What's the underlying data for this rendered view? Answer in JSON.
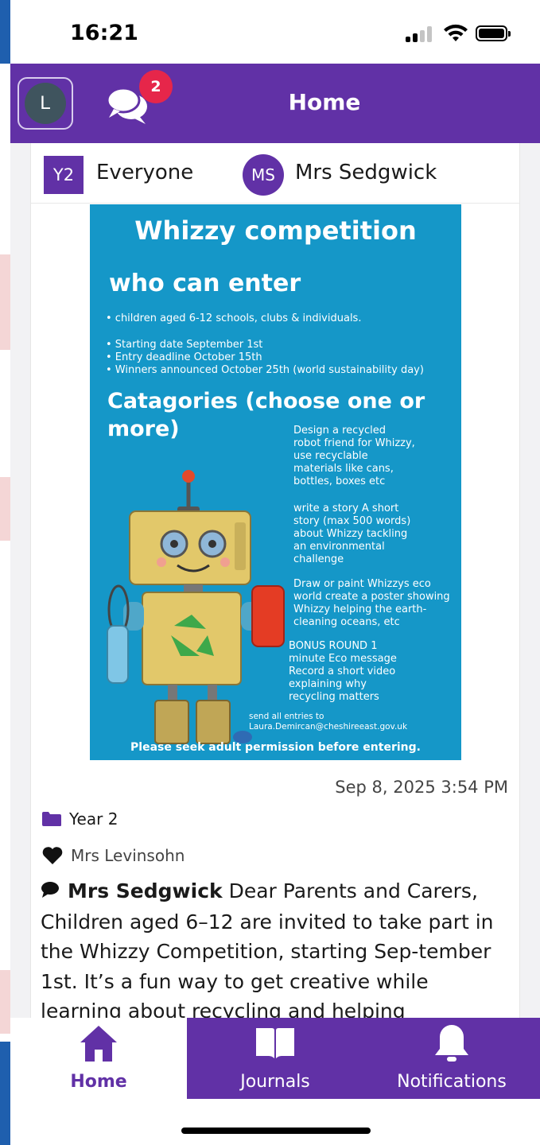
{
  "status_bar": {
    "time": "16:21",
    "icons": [
      "cellular-signal-icon",
      "wifi-icon",
      "battery-icon"
    ]
  },
  "header": {
    "avatar_initial": "L",
    "messages_badge": "2",
    "title": "Home",
    "accent_color": "#6131a6",
    "badge_color": "#e6264a"
  },
  "post": {
    "class_code": "Y2",
    "audience": "Everyone",
    "author_initials": "MS",
    "author_name": "Mrs Sedgwick",
    "poster": {
      "title": "Whizzy competition",
      "who_heading": "who can enter",
      "who_items": [
        "• children aged 6-12  schools, clubs & individuals."
      ],
      "date_items": [
        "• Starting date September 1st",
        "• Entry deadline October 15th",
        "• Winners announced October 25th (world sustainability day)"
      ],
      "categories_heading": "Catagories (choose one or more)",
      "category_1": [
        "Design a recycled",
        "robot friend for Whizzy,",
        "use recyclable",
        "materials like cans,",
        "bottles, boxes etc"
      ],
      "category_2": [
        "write a story A short",
        "story (max 500 words)",
        "about Whizzy tackling",
        "an environmental",
        "challenge"
      ],
      "category_3": [
        "Draw or paint Whizzys eco",
        "world create a poster showing",
        "Whizzy helping the earth-",
        "cleaning oceans, etc"
      ],
      "bonus": [
        "BONUS ROUND 1",
        "minute Eco message",
        "Record a short video",
        "explaining why",
        "recycling matters"
      ],
      "send_to": [
        "send all entries to",
        "Laura.Demircan@cheshireeast.gov.uk"
      ],
      "footer": "Please seek adult permission before entering.",
      "background_color": "#1597c8"
    },
    "date": "Sep 8, 2025 3:54 PM",
    "group": "Year 2",
    "liked_by": "Mrs Levinsohn",
    "body_author": "Mrs Sedgwick",
    "body_text": " Dear Parents and Carers, Children aged 6–12 are invited to take part in the Whizzy Competition, starting Sep-tember 1st. It’s a fun way to get creative while learning about recycling and helping"
  },
  "bottom_nav": {
    "items": [
      {
        "label": "Home",
        "icon": "home-icon",
        "active": true
      },
      {
        "label": "Journals",
        "icon": "book-icon",
        "active": false
      },
      {
        "label": "Notifications",
        "icon": "bell-icon",
        "active": false
      }
    ]
  }
}
